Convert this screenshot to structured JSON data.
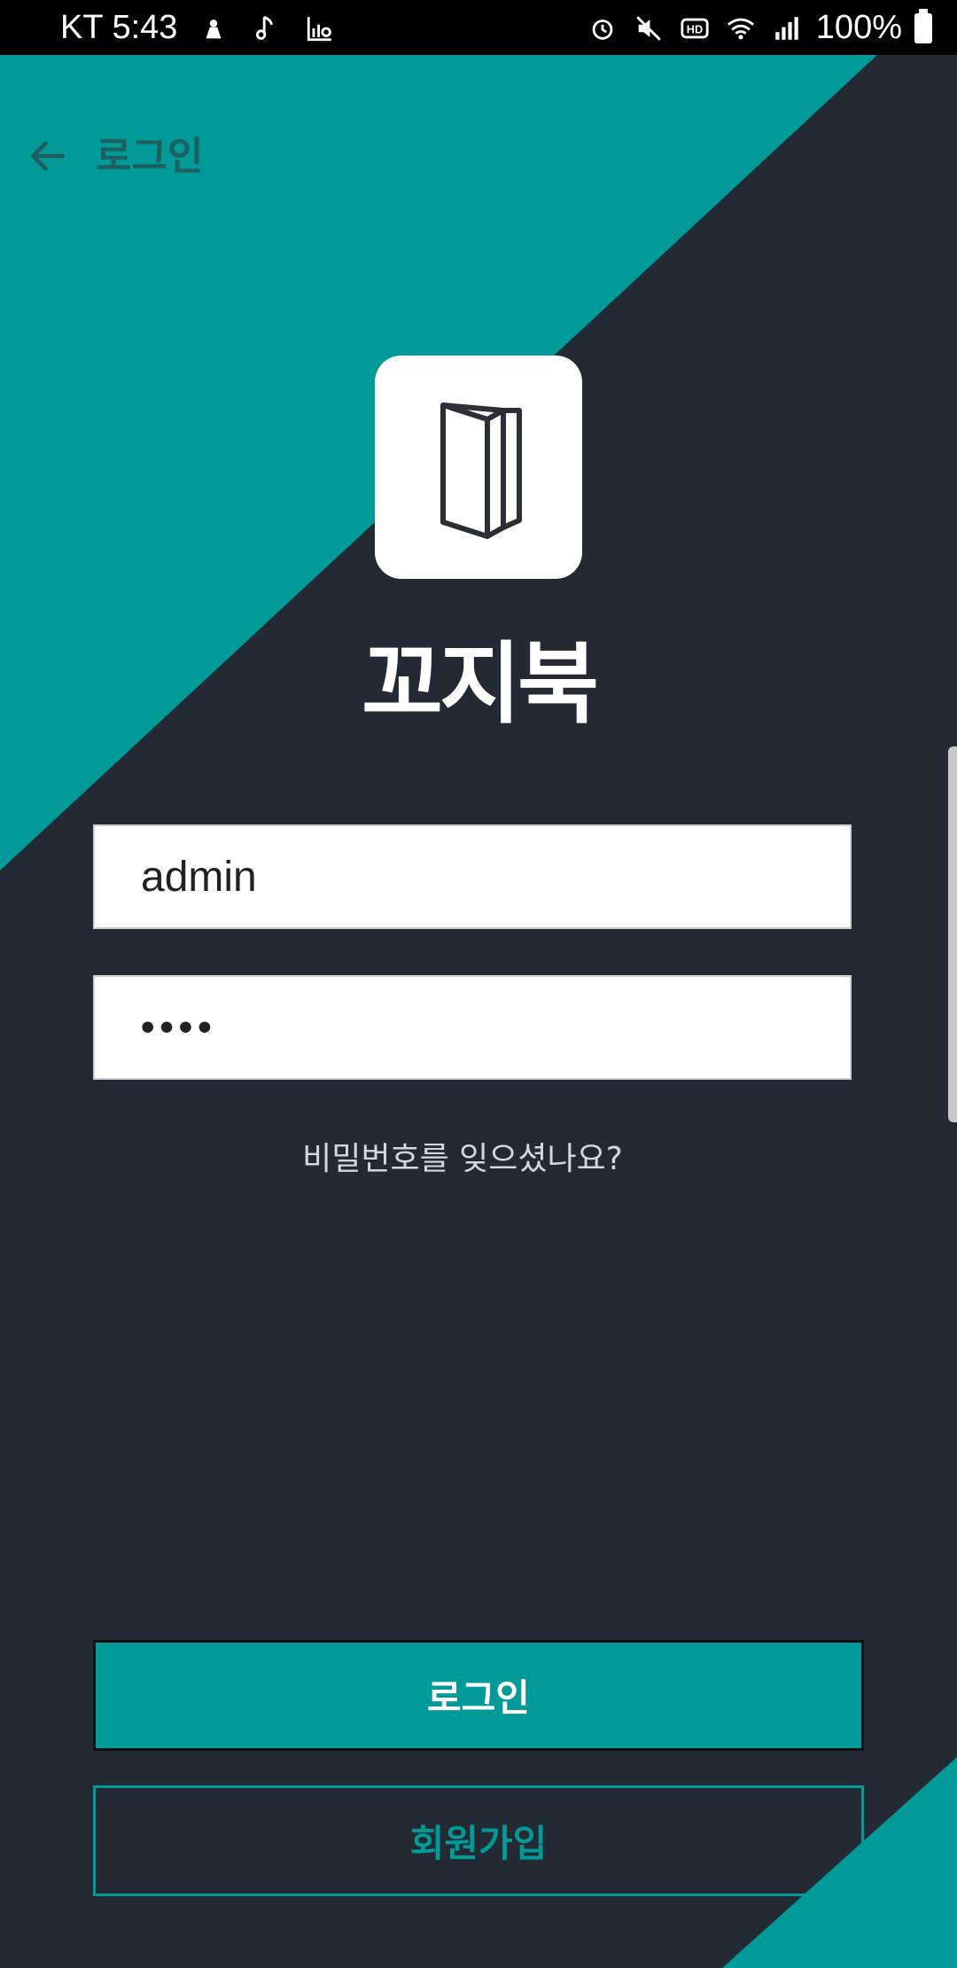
{
  "status_bar": {
    "carrier": "KT",
    "time": "5:43",
    "battery": "100%",
    "left_icons": [
      "notification-icon",
      "music-note-icon",
      "data-usage-icon"
    ],
    "right_icons": [
      "alarm-icon",
      "mute-icon",
      "hd-icon",
      "wifi-icon",
      "signal-icon",
      "battery-icon"
    ]
  },
  "header": {
    "title": "로그인",
    "back_icon": "arrow-left-icon"
  },
  "app": {
    "name": "꼬지북",
    "logo_icon": "book-icon"
  },
  "form": {
    "username_value": "admin",
    "password_value": "1234",
    "forgot_password": "비밀번호를 잊으셨나요?"
  },
  "buttons": {
    "login": "로그인",
    "signup": "회원가입"
  },
  "colors": {
    "teal": "#009a99",
    "dark": "#242a33",
    "header_text": "#1f5f5f"
  }
}
